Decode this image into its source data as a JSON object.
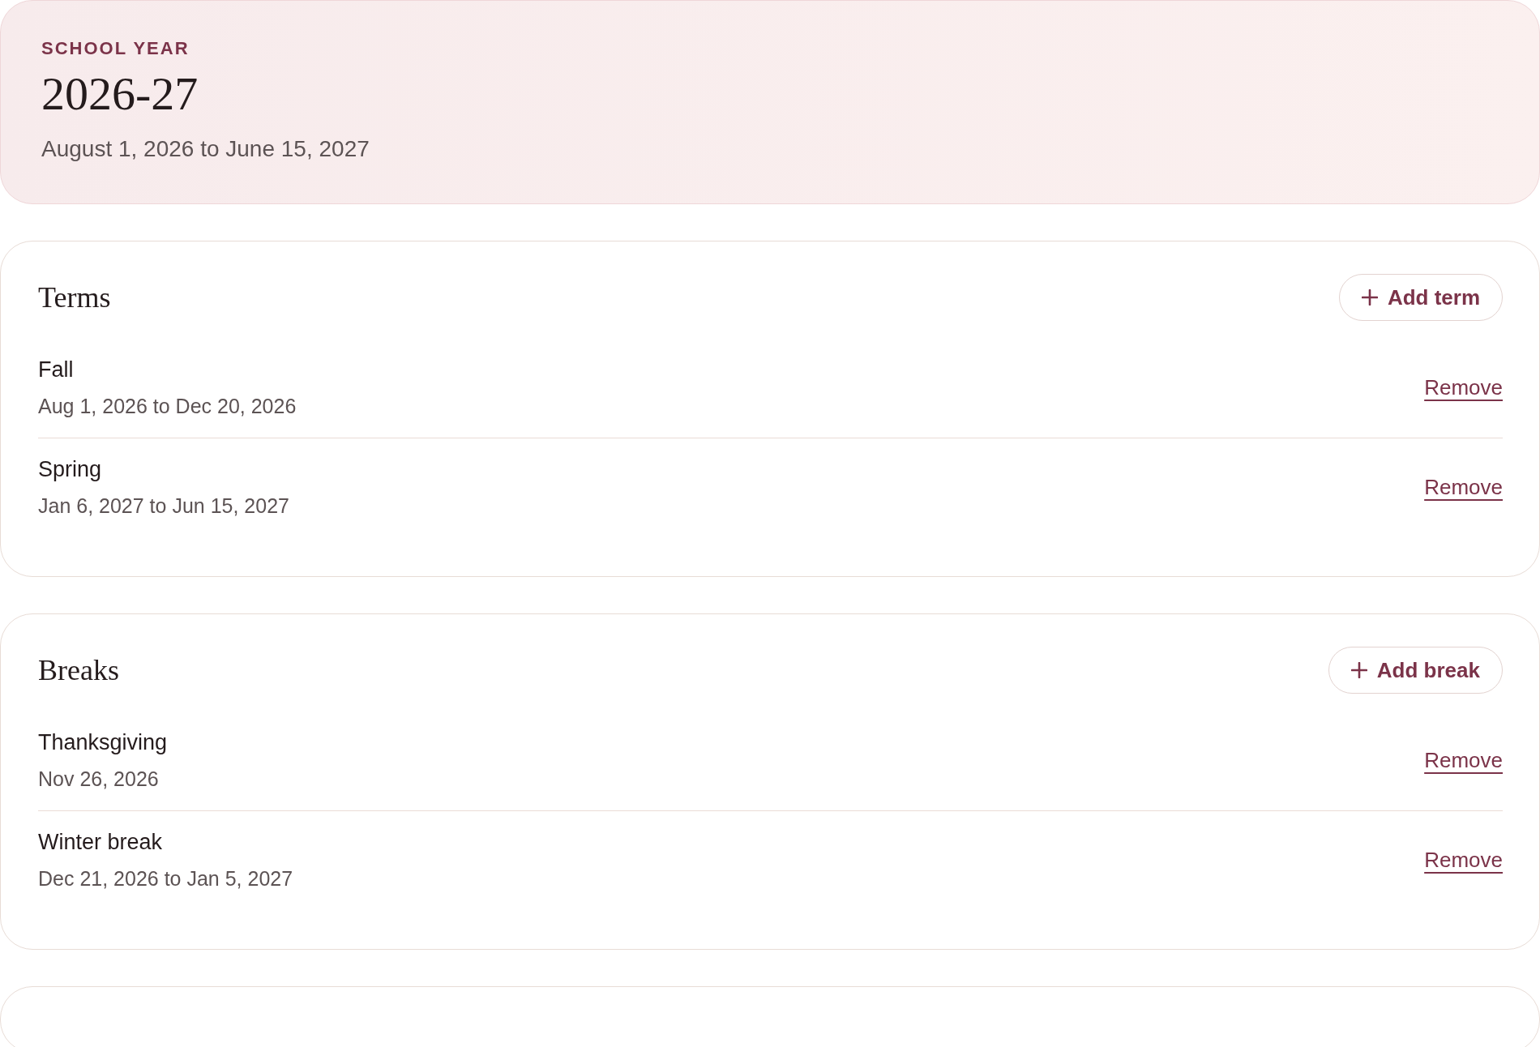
{
  "school_year": {
    "eyebrow": "SCHOOL YEAR",
    "title": "2026-27",
    "date_range": "August 1, 2026 to June 15, 2027"
  },
  "sections": [
    {
      "title": "Terms",
      "add_button": "Add term",
      "items": [
        {
          "name": "Fall",
          "dates": "Aug 1, 2026 to Dec 20, 2026",
          "action": "Remove"
        },
        {
          "name": "Spring",
          "dates": "Jan 6, 2027 to Jun 15, 2027",
          "action": "Remove"
        }
      ]
    },
    {
      "title": "Breaks",
      "add_button": "Add break",
      "items": [
        {
          "name": "Thanksgiving",
          "dates": "Nov 26, 2026",
          "action": "Remove"
        },
        {
          "name": "Winter break",
          "dates": "Dec 21, 2026 to Jan 5, 2027",
          "action": "Remove"
        }
      ]
    }
  ]
}
